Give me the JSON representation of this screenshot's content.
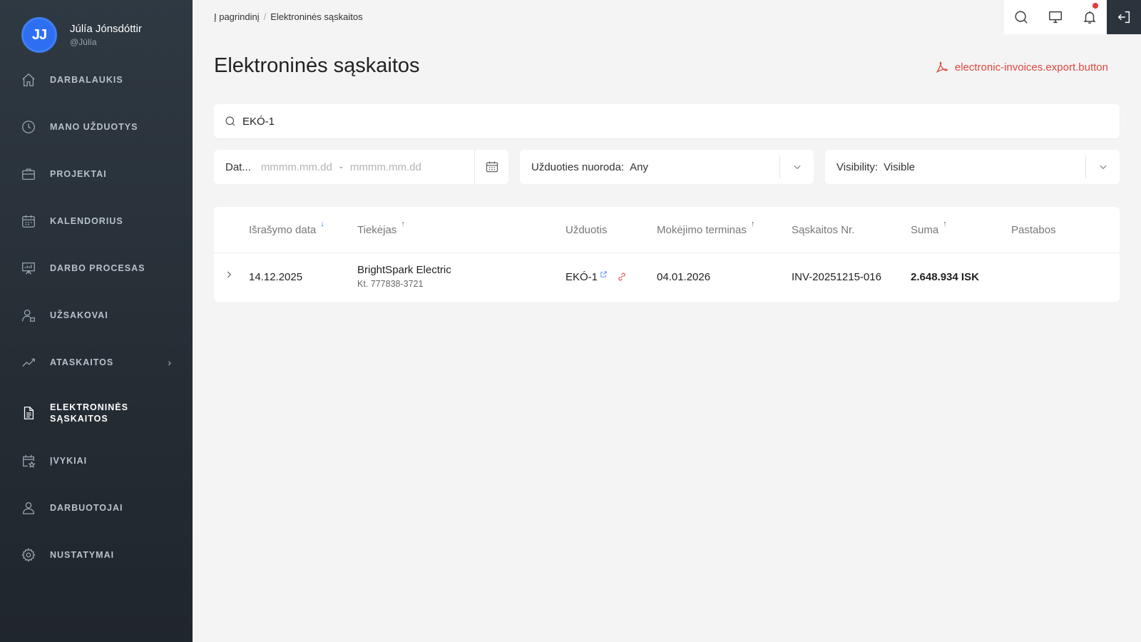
{
  "user": {
    "initials": "JJ",
    "name": "Júlía Jónsdóttir",
    "handle": "@Júlía"
  },
  "nav": [
    {
      "label": "DARBALAUKIS",
      "icon": "home-icon"
    },
    {
      "label": "MANO UŽDUOTYS",
      "icon": "clock-icon"
    },
    {
      "label": "PROJEKTAI",
      "icon": "briefcase-icon"
    },
    {
      "label": "KALENDORIUS",
      "icon": "calendar-icon"
    },
    {
      "label": "DARBO PROCESAS",
      "icon": "presentation-icon"
    },
    {
      "label": "UŽSAKOVAI",
      "icon": "customer-icon"
    },
    {
      "label": "ATASKAITOS",
      "icon": "chart-line-icon"
    },
    {
      "label_line1": "ELEKTRONINĖS",
      "label_line2": "SĄSKAITOS",
      "icon": "document-icon",
      "active": true
    },
    {
      "label": "ĮVYKIAI",
      "icon": "calendar-star-icon"
    },
    {
      "label": "DARBUOTOJAI",
      "icon": "users-icon"
    },
    {
      "label": "NUSTATYMAI",
      "icon": "gear-icon"
    }
  ],
  "breadcrumb": {
    "home": "Į pagrindinį",
    "separator": "/",
    "current": "Elektroninės sąskaitos"
  },
  "page": {
    "title": "Elektroninės sąskaitos",
    "export_label": "electronic-invoices.export.button"
  },
  "search": {
    "value": "EKÓ-1"
  },
  "filters": {
    "date_label": "Dat...",
    "date_from_placeholder": "mmmm.mm.dd",
    "date_separator": "-",
    "date_to_placeholder": "mmmm.mm.dd",
    "task_label": "Užduoties nuoroda:",
    "task_value": "Any",
    "visibility_label": "Visibility:",
    "visibility_value": "Visible"
  },
  "table": {
    "columns": [
      "Išrašymo data",
      "Tiekėjas",
      "Užduotis",
      "Mokėjimo terminas",
      "Sąskaitos Nr.",
      "Suma",
      "Pastabos"
    ],
    "rows": [
      {
        "issue_date": "14.12.2025",
        "supplier_name": "BrightSpark Electric",
        "supplier_kt": "Kt. 777838-3721",
        "task": "EKÓ-1",
        "due_date": "04.01.2026",
        "invoice_no": "INV-20251215-016",
        "amount": "2.648.934 ISK",
        "notes": ""
      }
    ]
  },
  "colors": {
    "accent_blue": "#2d6ff0",
    "export_red": "#e0473d",
    "sidebar_bg": "#2b343c"
  }
}
